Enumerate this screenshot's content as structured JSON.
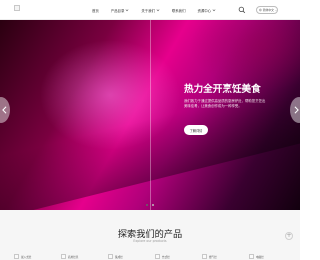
{
  "header": {
    "logo_icon": "broken-image-icon",
    "nav": [
      {
        "label": "首页",
        "has_dropdown": false
      },
      {
        "label": "产品目录",
        "has_dropdown": true
      },
      {
        "label": "关于我们",
        "has_dropdown": true
      },
      {
        "label": "联系我们",
        "has_dropdown": false
      },
      {
        "label": "资源中心",
        "has_dropdown": true
      }
    ],
    "search_icon": "search-icon",
    "language": {
      "label": "简体中文",
      "icon": "globe-icon"
    }
  },
  "hero": {
    "title": "热力全开烹饪美食",
    "description": "我们致力于通过提供高品质的厨房炉灶，帮助您烹饪出美味佳肴，让美食创作成为一种享受。",
    "button_label": "了解详情",
    "prev_icon": "chevron-left-icon",
    "next_icon": "chevron-right-icon",
    "slide_count": 2,
    "active_slide": 1
  },
  "products": {
    "title": "探索我们的产品",
    "subtitle": "Explore our products",
    "more_icon": "plus-icon",
    "items": [
      {
        "label": "嵌入式灶"
      },
      {
        "label": "商用灶具"
      },
      {
        "label": "集成灶"
      },
      {
        "label": "台式灶"
      },
      {
        "label": "燃气灶"
      },
      {
        "label": "电磁灶"
      }
    ]
  },
  "colors": {
    "hero_accent": "#e6008c",
    "hero_dark": "#2a0010",
    "section_bg": "#f6f6f6"
  }
}
